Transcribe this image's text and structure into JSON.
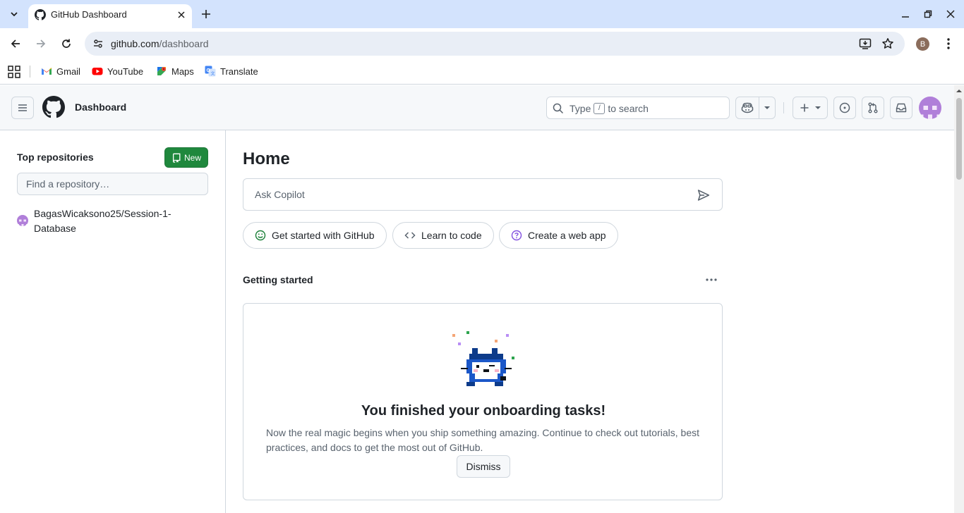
{
  "browser": {
    "tab_title": "GitHub Dashboard",
    "url_host": "github.com",
    "url_path": "/dashboard",
    "profile_initial": "B",
    "bookmarks": [
      {
        "label": "Gmail",
        "icon": "gmail-icon"
      },
      {
        "label": "YouTube",
        "icon": "youtube-icon"
      },
      {
        "label": "Maps",
        "icon": "maps-icon"
      },
      {
        "label": "Translate",
        "icon": "translate-icon"
      }
    ]
  },
  "header": {
    "context": "Dashboard",
    "search_prefix": "Type",
    "search_key": "/",
    "search_suffix": "to search"
  },
  "sidebar": {
    "title": "Top repositories",
    "new_label": "New",
    "find_placeholder": "Find a repository…",
    "repos": [
      {
        "name": "BagasWicaksono25/Session-1-Database"
      }
    ]
  },
  "main": {
    "title": "Home",
    "copilot_placeholder": "Ask Copilot",
    "chips": [
      {
        "label": "Get started with GitHub",
        "icon": "smiley-icon"
      },
      {
        "label": "Learn to code",
        "icon": "code-icon"
      },
      {
        "label": "Create a web app",
        "icon": "question-icon"
      }
    ],
    "getting_started_title": "Getting started",
    "onboarding": {
      "title": "You finished your onboarding tasks!",
      "description": "Now the real magic begins when you ship something amazing. Continue to check out tutorials, best practices, and docs to get the most out of GitHub.",
      "dismiss_label": "Dismiss"
    }
  },
  "colors": {
    "tabbar": "#d3e3fd",
    "primary_green": "#1f883d",
    "border": "#d0d7de",
    "header_bg": "#f6f8fa"
  }
}
